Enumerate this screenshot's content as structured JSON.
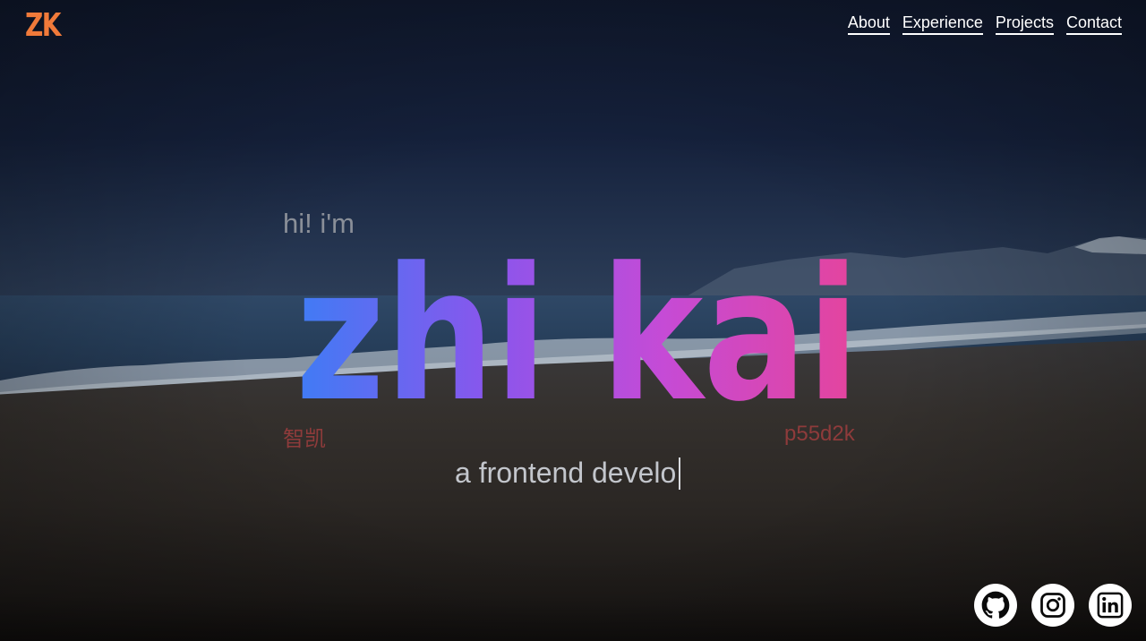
{
  "header": {
    "logo_text": "ZK",
    "logo_color": "#f07a3a"
  },
  "nav": {
    "items": [
      {
        "label": "About"
      },
      {
        "label": "Experience"
      },
      {
        "label": "Projects"
      },
      {
        "label": "Contact"
      }
    ]
  },
  "hero": {
    "greeting": "hi! i'm",
    "name": "zhi kai",
    "name_gradient": [
      "#3f7cf5",
      "#8b55ec",
      "#c54bd6",
      "#e5449c"
    ],
    "chinese_name": "智凯",
    "handle": "p55d2k",
    "typed_role": "a frontend develo"
  },
  "social": {
    "items": [
      {
        "icon": "github-icon"
      },
      {
        "icon": "instagram-icon"
      },
      {
        "icon": "linkedin-icon"
      }
    ]
  }
}
